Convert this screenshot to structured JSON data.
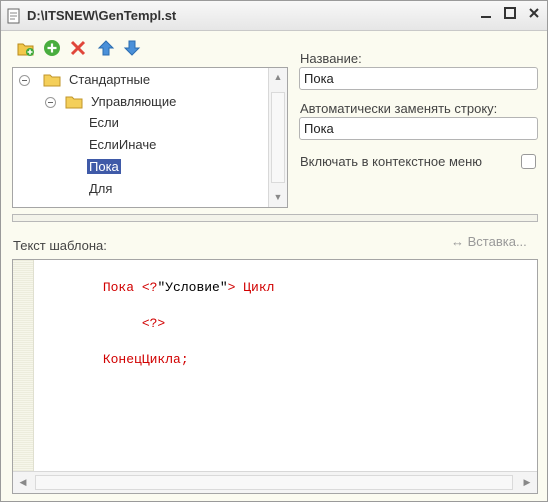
{
  "window": {
    "title": "D:\\ITSNEW\\GenTempl.st",
    "minimize": "▁",
    "maximize": "☐",
    "close": "✕"
  },
  "toolbar": {
    "icons": [
      "new-folder-icon",
      "add-icon",
      "delete-icon",
      "move-up-icon",
      "move-down-icon"
    ]
  },
  "tree": {
    "items": [
      {
        "label": "Стандартные",
        "type": "folder"
      },
      {
        "label": "Управляющие",
        "type": "folder"
      },
      {
        "label": "Если",
        "type": "item"
      },
      {
        "label": "ЕслиИначе",
        "type": "item"
      },
      {
        "label": "Пока",
        "type": "item",
        "selected": true
      },
      {
        "label": "Для",
        "type": "item"
      }
    ]
  },
  "form": {
    "name_label": "Название:",
    "name_value": "Пока",
    "replace_label": "Автоматически заменять строку:",
    "replace_value": "Пока",
    "context_label": "Включать в контекстное меню",
    "context_checked": false
  },
  "template": {
    "label": "Текст шаблона:",
    "insert_label": "Вставка...",
    "code_lines": [
      {
        "segments": [
          {
            "t": "Пока ",
            "c": "kw"
          },
          {
            "t": "<?",
            "c": "kw"
          },
          {
            "t": "\"Условие\"",
            "c": "str"
          },
          {
            "t": "> Цикл",
            "c": "kw"
          }
        ]
      },
      {
        "segments": []
      },
      {
        "segments": [
          {
            "t": "     <?>",
            "c": "kw"
          }
        ]
      },
      {
        "segments": []
      },
      {
        "segments": [
          {
            "t": "КонецЦикла;",
            "c": "kw"
          }
        ]
      }
    ]
  },
  "colors": {
    "selection": "#3f5aa8",
    "keyword": "#d10000",
    "window_bg": "#fbfbf0"
  }
}
